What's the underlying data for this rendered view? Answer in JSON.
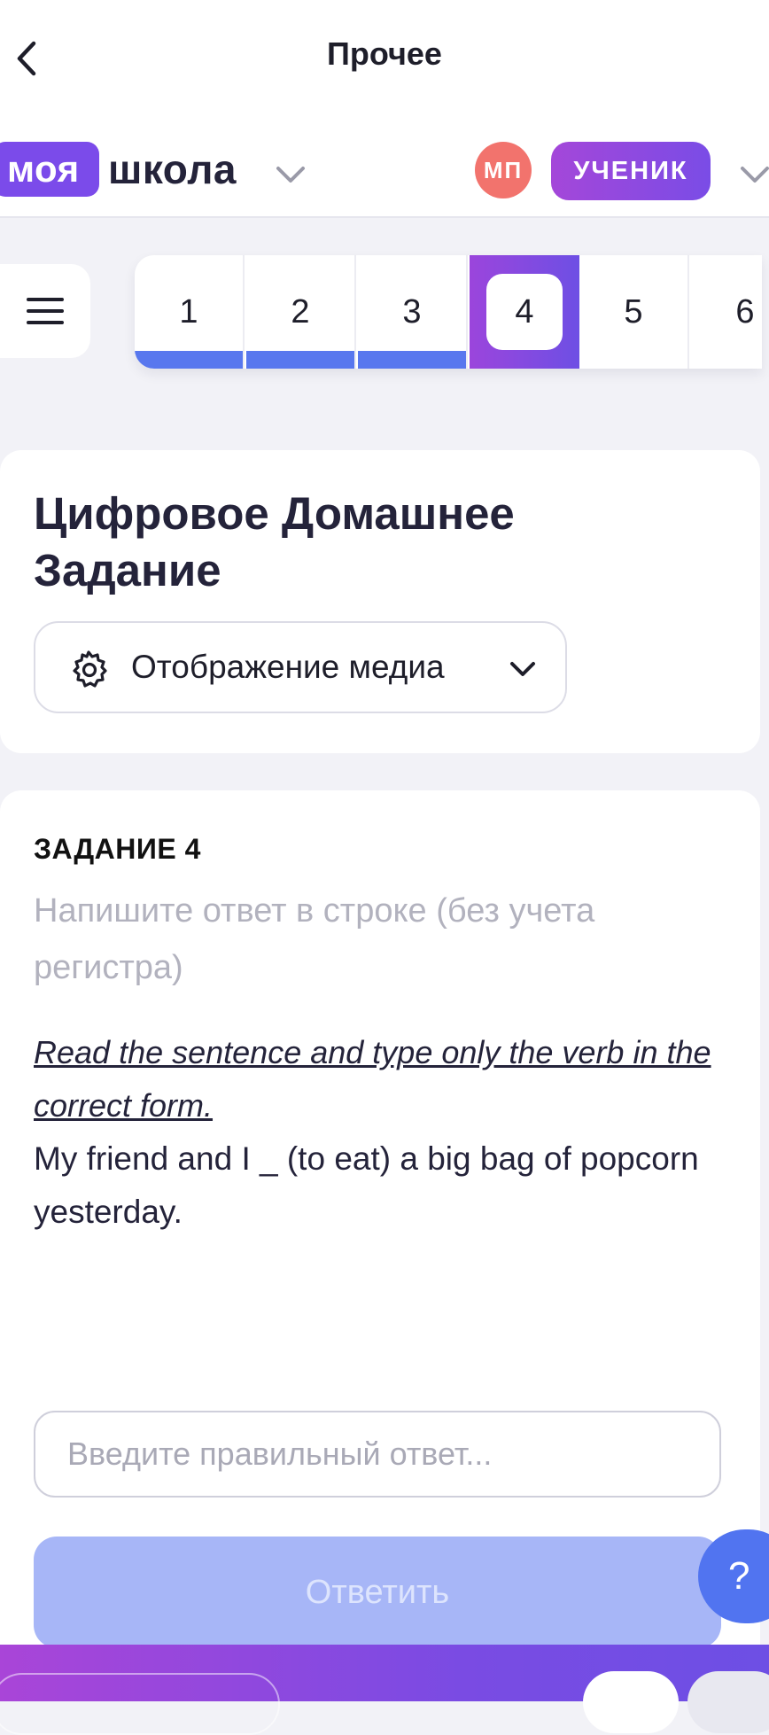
{
  "appbar": {
    "title": "Прочее",
    "back_icon": "chevron-left-icon"
  },
  "school": {
    "logo_part1": "моя",
    "logo_part2": "школа",
    "avatar_initials": "МП",
    "role": "УЧЕНИК"
  },
  "tasks": {
    "numbers": [
      "1",
      "2",
      "3",
      "4",
      "5",
      "6"
    ],
    "completed": [
      "1",
      "2",
      "3"
    ],
    "active": "4"
  },
  "page": {
    "title": "Цифровое Домашнее Задание",
    "media_select_label": "Отображение медиа"
  },
  "task": {
    "heading": "ЗАДАНИЕ 4",
    "hint": "Напишите ответ в строке (без учета регистра)",
    "instruction": "Read the sentence and type only the verb in the correct form.",
    "sentence": "My friend and I _ (to eat) a big bag of popcorn yesterday.",
    "input_placeholder": "Введите правильный ответ...",
    "submit_label": "Ответить"
  },
  "help": {
    "label": "?"
  },
  "colors": {
    "accent_purple": "#7b4bea",
    "progress_blue": "#5877ee",
    "avatar_red": "#f2736d",
    "submit_disabled": "#a7b6f7",
    "help_blue": "#5174f0"
  }
}
